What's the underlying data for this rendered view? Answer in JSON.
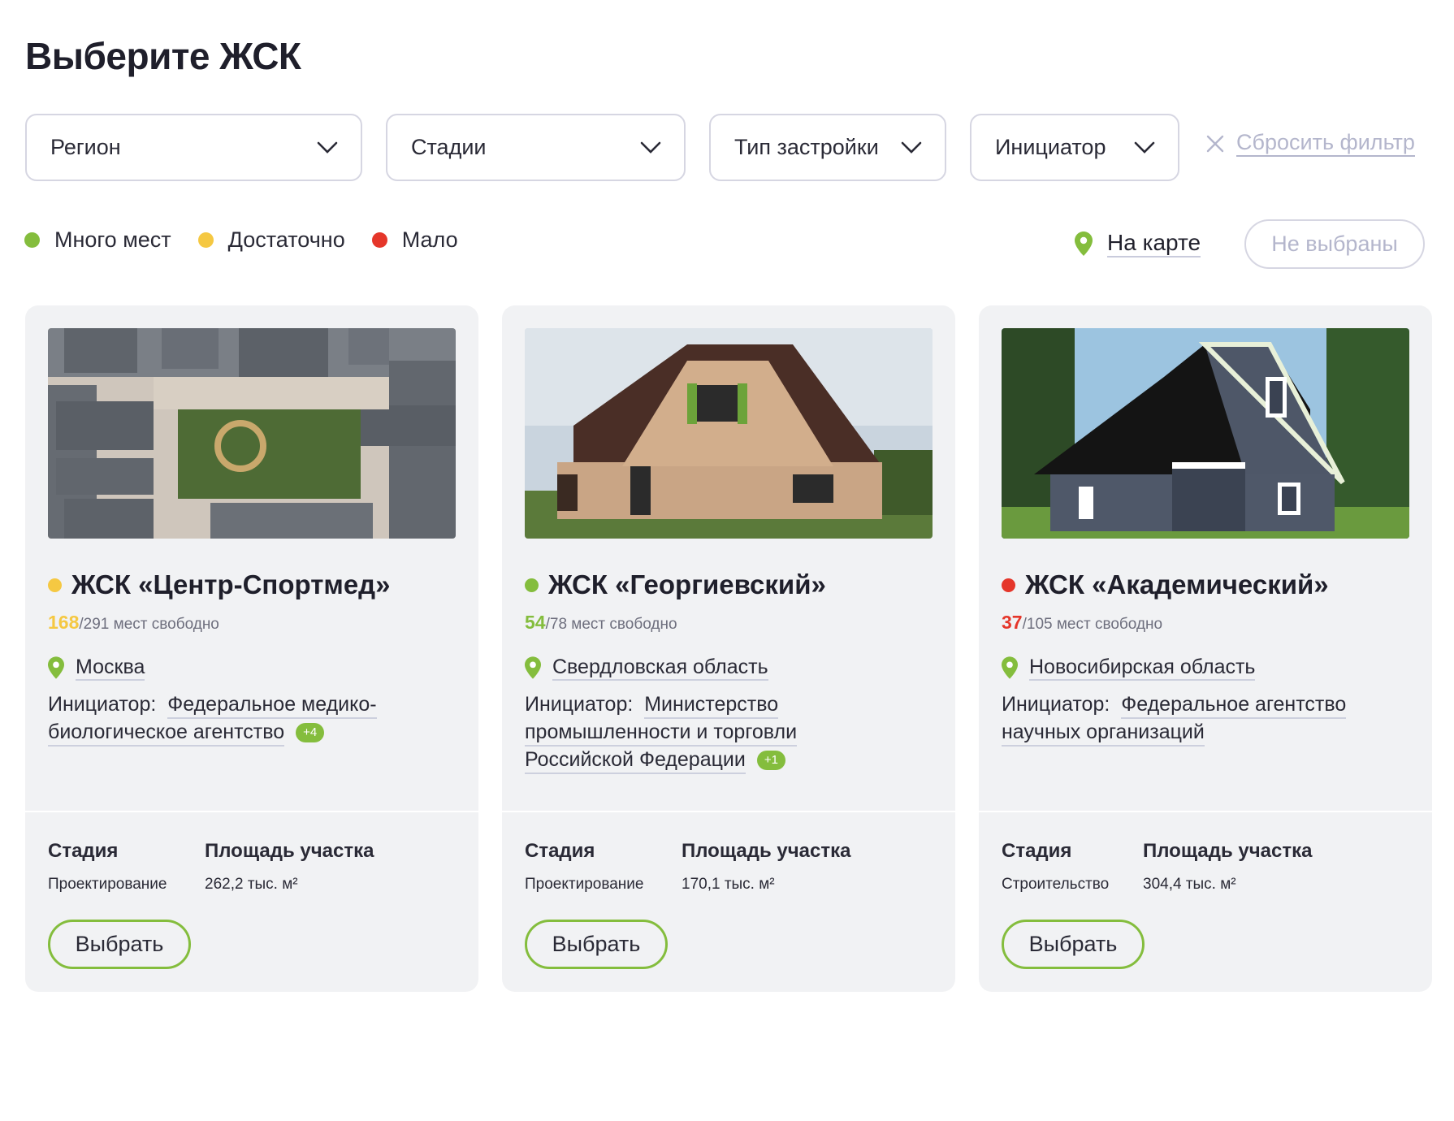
{
  "page": {
    "title": "Выберите ЖСК"
  },
  "filters": [
    {
      "label": "Регион"
    },
    {
      "label": "Стадии"
    },
    {
      "label": "Тип застройки"
    },
    {
      "label": "Инициатор"
    }
  ],
  "reset_label": "Сбросить фильтр",
  "legend": [
    {
      "label": "Много мест",
      "color": "#84bd3d"
    },
    {
      "label": "Достаточно",
      "color": "#f5c842"
    },
    {
      "label": "Мало",
      "color": "#e5362a"
    }
  ],
  "map_link": "На карте",
  "selection_status": "Не выбраны",
  "labels": {
    "stage": "Стадия",
    "area": "Площадь участка",
    "initiator": "Инициатор:",
    "choose": "Выбрать",
    "seats_suffix": "мест свободно"
  },
  "cards": [
    {
      "name": "ЖСК «Центр-Спортмед»",
      "status_color": "#f5c842",
      "seats_free": "168",
      "seats_total": "/291",
      "region": "Москва",
      "initiator": "Федеральное медико-биологическое агентство",
      "initiator_more": "+4",
      "stage": "Проектирование",
      "area": "262,2 тыс. м²"
    },
    {
      "name": "ЖСК «Георгиевский»",
      "status_color": "#84bd3d",
      "seats_free": "54",
      "seats_total": "/78",
      "region": "Свердловская область",
      "initiator": "Министерство промышленности и торговли Российской Федерации",
      "initiator_more": "+1",
      "stage": "Проектирование",
      "area": "170,1 тыс. м²"
    },
    {
      "name": "ЖСК «Академический»",
      "status_color": "#e5362a",
      "seats_free": "37",
      "seats_total": "/105",
      "region": "Новосибирская область",
      "initiator": "Федеральное агентство научных организаций",
      "initiator_more": "",
      "stage": "Строительство",
      "area": "304,4 тыс. м²"
    }
  ]
}
